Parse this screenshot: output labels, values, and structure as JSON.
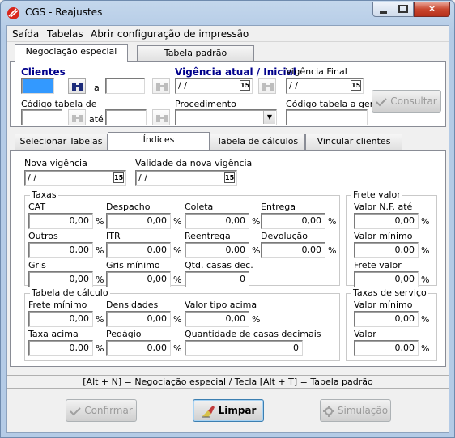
{
  "window": {
    "title": "CGS - Reajustes",
    "close_glyph": "✕"
  },
  "menu": [
    {
      "label": "Saída"
    },
    {
      "label": "Tabelas"
    },
    {
      "label": "Abrir configuração de impressão"
    }
  ],
  "top_tabs": [
    {
      "label": "Negociação especial",
      "active": true
    },
    {
      "label": "Tabela padrão",
      "active": false
    }
  ],
  "header": {
    "clientes_label": "Clientes",
    "a_label": "a",
    "vigencia_atual_label": "Vigência atual / Inicial",
    "vigencia_atual_value": " / /",
    "vigencia_final_label": "Vigência Final",
    "vigencia_final_value": " / /",
    "codigo_tabela_de_label": "Código tabela de",
    "ate_label": "até",
    "procedimento_label": "Procedimento",
    "codigo_tabela_gerar_label": "Código tabela a gerar",
    "consultar_label": "Consultar"
  },
  "inner_tabs": [
    {
      "label": "Selecionar Tabelas",
      "active": false
    },
    {
      "label": "Índices",
      "active": true
    },
    {
      "label": "Tabela de cálculos",
      "active": false
    },
    {
      "label": "Vincular clientes",
      "active": false
    }
  ],
  "indices": {
    "nova_vigencia_label": "Nova vigência",
    "nova_vigencia_value": " / /",
    "validade_label": "Validade da nova vigência",
    "validade_value": " / /",
    "cal_glyph": "15",
    "taxas": {
      "title": "Taxas",
      "fields": [
        {
          "label": "CAT",
          "value": "0,00",
          "unit": "%"
        },
        {
          "label": "Despacho",
          "value": "0,00",
          "unit": "%"
        },
        {
          "label": "Coleta",
          "value": "0,00",
          "unit": "%"
        },
        {
          "label": "Entrega",
          "value": "0,00",
          "unit": "%"
        },
        {
          "label": "Outros",
          "value": "0,00",
          "unit": "%"
        },
        {
          "label": "ITR",
          "value": "0,00",
          "unit": "%"
        },
        {
          "label": "Reentrega",
          "value": "0,00",
          "unit": "%"
        },
        {
          "label": "Devolução",
          "value": "0,00",
          "unit": "%"
        },
        {
          "label": "Gris",
          "value": "0,00",
          "unit": "%"
        },
        {
          "label": "Gris mínimo",
          "value": "0,00",
          "unit": "%"
        },
        {
          "label": "Qtd. casas dec.",
          "value": "0",
          "unit": ""
        }
      ]
    },
    "frete_valor": {
      "title": "Frete valor",
      "fields": [
        {
          "label": "Valor N.F. até",
          "value": "0,00",
          "unit": "%"
        },
        {
          "label": "Valor mínimo",
          "value": "0,00",
          "unit": "%"
        },
        {
          "label": "Frete valor",
          "value": "0,00",
          "unit": "%"
        }
      ]
    },
    "tabela_calculo": {
      "title": "Tabela de cálculo",
      "fields": [
        {
          "label": "Frete mínimo",
          "value": "0,00",
          "unit": "%"
        },
        {
          "label": "Densidades",
          "value": "0,00",
          "unit": "%"
        },
        {
          "label": "Valor tipo acima",
          "value": "0,00",
          "unit": "%"
        },
        {
          "label": "Taxa acima",
          "value": "0,00",
          "unit": "%"
        },
        {
          "label": "Pedágio",
          "value": "0,00",
          "unit": "%"
        },
        {
          "label": "Quantidade de casas decimais",
          "value": "0",
          "unit": ""
        }
      ]
    },
    "taxas_servico": {
      "title": "Taxas de serviço",
      "fields": [
        {
          "label": "Valor mínimo",
          "value": "0,00",
          "unit": "%"
        },
        {
          "label": "Valor",
          "value": "0,00",
          "unit": "%"
        }
      ]
    }
  },
  "status_text": "[Alt + N] = Negociação especial / Tecla [Alt + T] = Tabela padrão",
  "buttons": {
    "confirmar": "Confirmar",
    "limpar": "Limpar",
    "simulacao": "Simulação"
  }
}
